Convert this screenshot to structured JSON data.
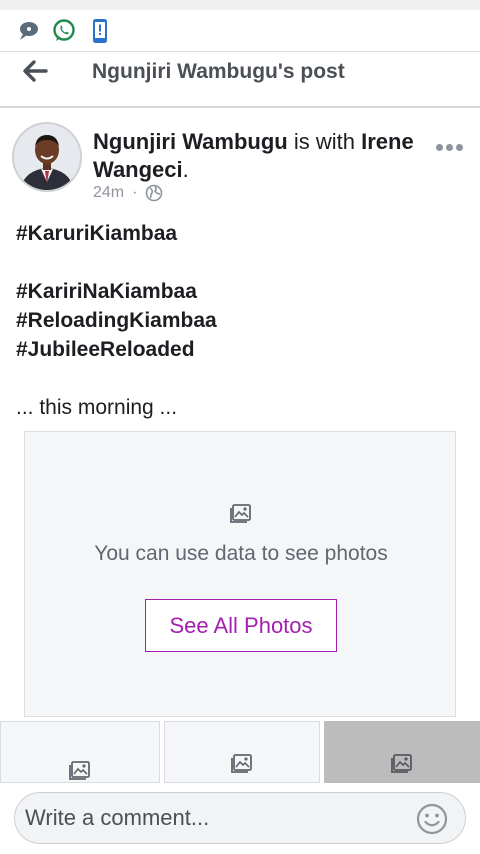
{
  "status_bar": {
    "icons": [
      "chat-bubble-icon",
      "whatsapp-icon",
      "phone-alert-icon"
    ],
    "colors": {
      "chat": "#5b6b7a",
      "whatsapp": "#1f8a4c",
      "phone": "#2a73c9"
    }
  },
  "header": {
    "title": "Ngunjiri Wambugu's post",
    "back_icon": "arrow-left-icon"
  },
  "post": {
    "author": "Ngunjiri Wambugu",
    "with_text": "is with",
    "tagged": "Irene Wangeci",
    "period": ".",
    "time": "24m",
    "separator": "·",
    "privacy_icon": "globe-icon",
    "more_icon": "more-dots-icon",
    "hashtags": [
      "#KaruriKiambaa",
      "#KaririNaKiambaa",
      "#ReloadingKiambaa",
      "#JubileeReloaded"
    ],
    "caption": "... this morning ..."
  },
  "photos": {
    "message": "You can use data to see photos",
    "button_label": "See All Photos",
    "icon": "image-icon"
  },
  "comment": {
    "placeholder": "Write a comment...",
    "emoji_icon": "smiley-icon"
  },
  "colors": {
    "accent": "#a41fb0",
    "text": "#1c1e21",
    "muted": "#90949c"
  }
}
